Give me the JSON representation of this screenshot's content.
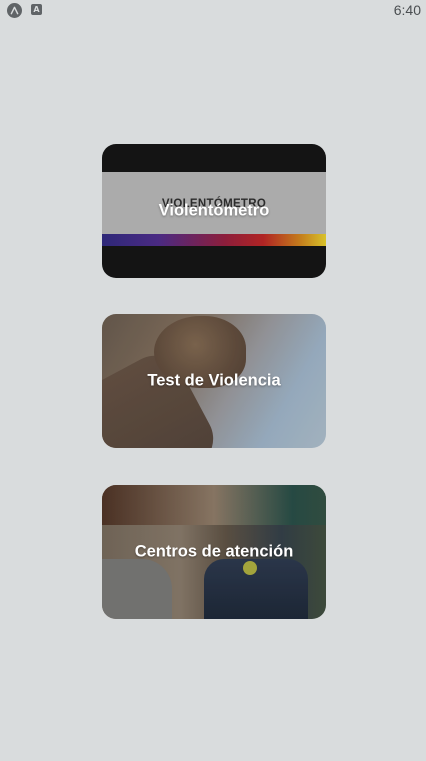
{
  "status_bar": {
    "time": "6:40",
    "icons": [
      "app-launcher-icon",
      "font-notification-icon"
    ],
    "notification_letter": "A"
  },
  "cards": [
    {
      "label": "Violentómetro",
      "logo_text": "VIOLENTÓMETRO",
      "icon": "violentometro-banner-image"
    },
    {
      "label": "Test de Violencia",
      "icon": "fist-image"
    },
    {
      "label": "Centros de atención",
      "icon": "support-group-image"
    }
  ],
  "colors": {
    "background": "#d9dcdd",
    "card_text": "#ffffff",
    "gradient_start": "#2e2878",
    "gradient_end": "#d8c22a"
  }
}
